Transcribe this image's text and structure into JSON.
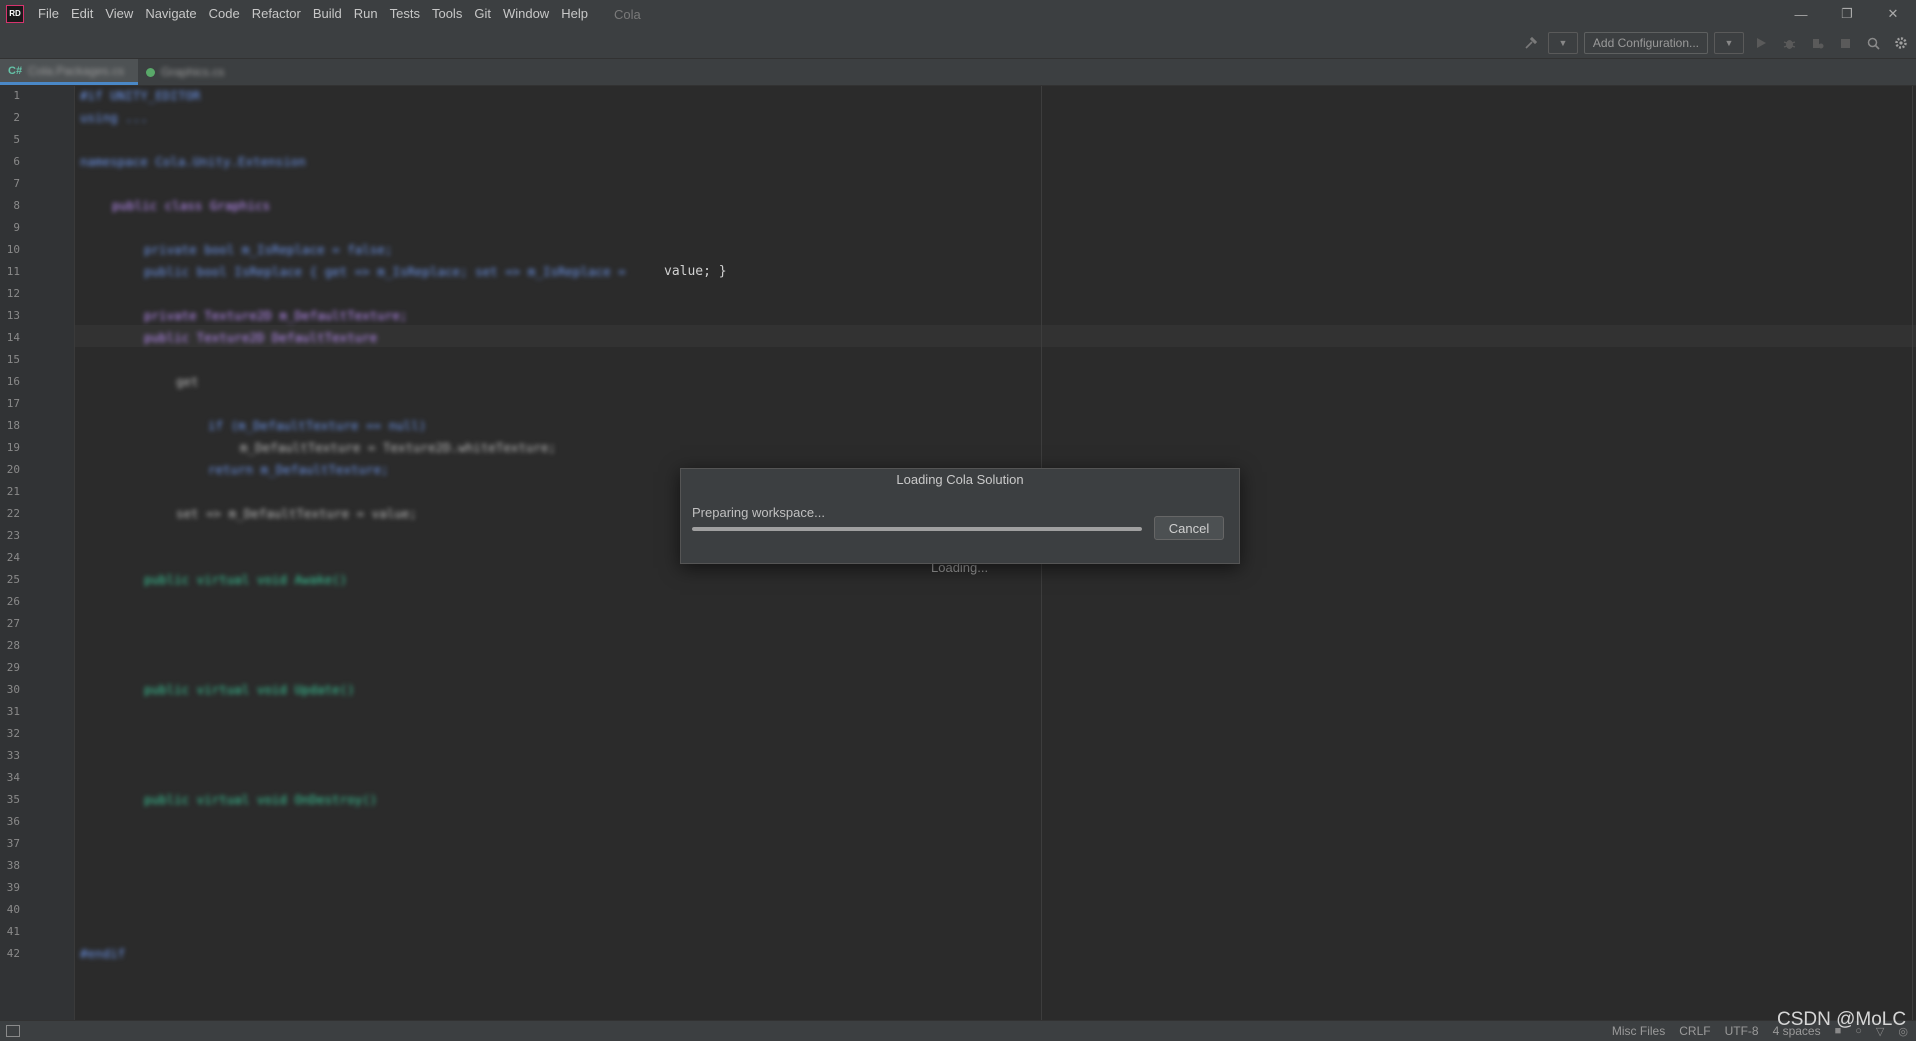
{
  "titlebar": {
    "app_badge": "RD",
    "menu": [
      "File",
      "Edit",
      "View",
      "Navigate",
      "Code",
      "Refactor",
      "Build",
      "Run",
      "Tests",
      "Tools",
      "Git",
      "Window",
      "Help"
    ],
    "project": "Cola",
    "window_controls": {
      "minimize": "—",
      "restore": "❐",
      "close": "✕"
    }
  },
  "toolbar": {
    "add_configuration": "Add Configuration...",
    "icons": [
      "hammer-icon",
      "run-icon",
      "debug-icon",
      "coverage-icon",
      "stop-icon",
      "search-icon",
      "settings-icon"
    ]
  },
  "tabs": [
    {
      "badge": "C#",
      "label": "Cola.Packages.cs",
      "active": true
    },
    {
      "label": "Graphics.cs",
      "active": false
    }
  ],
  "editor": {
    "line_numbers": [
      "1",
      "2",
      "5",
      "6",
      "7",
      "8",
      "9",
      "10",
      "11",
      "12",
      "13",
      "14",
      "15",
      "16",
      "17",
      "18",
      "19",
      "20",
      "21",
      "22",
      "23",
      "24",
      "25",
      "26",
      "27",
      "28",
      "29",
      "30",
      "31",
      "32",
      "33",
      "34",
      "35",
      "36",
      "37",
      "38",
      "39",
      "40",
      "41",
      "42"
    ],
    "code_blurred": {
      "l1": "#if UNITY_EDITOR",
      "l2": "using ...",
      "l6": "namespace Cola.Unity.Extension",
      "l8": "public class Graphics",
      "l10": "private bool m_IsReplace = false;",
      "l11": "public bool IsReplace { get => m_IsReplace; set => m_IsReplace =",
      "l13": "private Texture2D m_DefaultTexture;",
      "l14": "public Texture2D DefaultTexture",
      "l16": "get",
      "l18": "if (m_DefaultTexture == null)",
      "l19": "m_DefaultTexture = Texture2D.whiteTexture;",
      "l20": "return m_DefaultTexture;",
      "l22": "set => m_DefaultTexture = value;",
      "l25": "public virtual void Awake()",
      "l30": "public virtual void Update()",
      "l35": "public virtual void OnDestroy()",
      "l42": "#endif"
    },
    "visible_code": "value; }",
    "loading": "Loading..."
  },
  "dialog": {
    "title": "Loading Cola Solution",
    "status": "Preparing workspace...",
    "progress": 1.0,
    "cancel": "Cancel"
  },
  "statusbar": {
    "misc_files": "Misc Files",
    "line_endings": "CRLF",
    "encoding": "UTF-8",
    "indent": "4 spaces"
  },
  "watermark": "CSDN @MoLC"
}
